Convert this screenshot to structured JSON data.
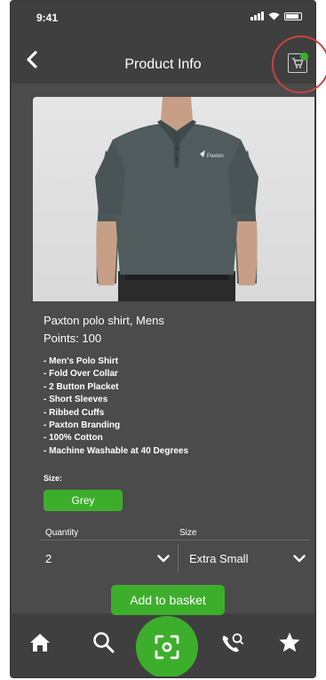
{
  "status_bar": {
    "time": "9:41"
  },
  "header": {
    "title": "Product Info"
  },
  "product": {
    "name": "Paxton polo shirt, Mens",
    "points": "Points: 100",
    "logo_text": "Paxton",
    "features": [
      "Men's Polo Shirt",
      "Fold Over Collar",
      "2 Button Placket",
      "Short Sleeves",
      "Ribbed Cuffs",
      "Paxton Branding",
      "100% Cotton",
      "Machine Washable at 40 Degrees"
    ]
  },
  "size_section": {
    "label": "Size:",
    "selected_colour": "Grey"
  },
  "selectors": {
    "quantity_label": "Quantity",
    "quantity_value": "2",
    "size_label": "Size",
    "size_value": "Extra Small"
  },
  "actions": {
    "add_to_basket": "Add to basket"
  },
  "bottom_nav": {
    "items": [
      "home-icon",
      "search-icon",
      "scan-icon",
      "phone-icon",
      "star-icon"
    ]
  },
  "colors": {
    "accent": "#3dae2b",
    "background": "#4b4b4b",
    "header": "#3f3f3f",
    "highlight": "#c8433f"
  }
}
